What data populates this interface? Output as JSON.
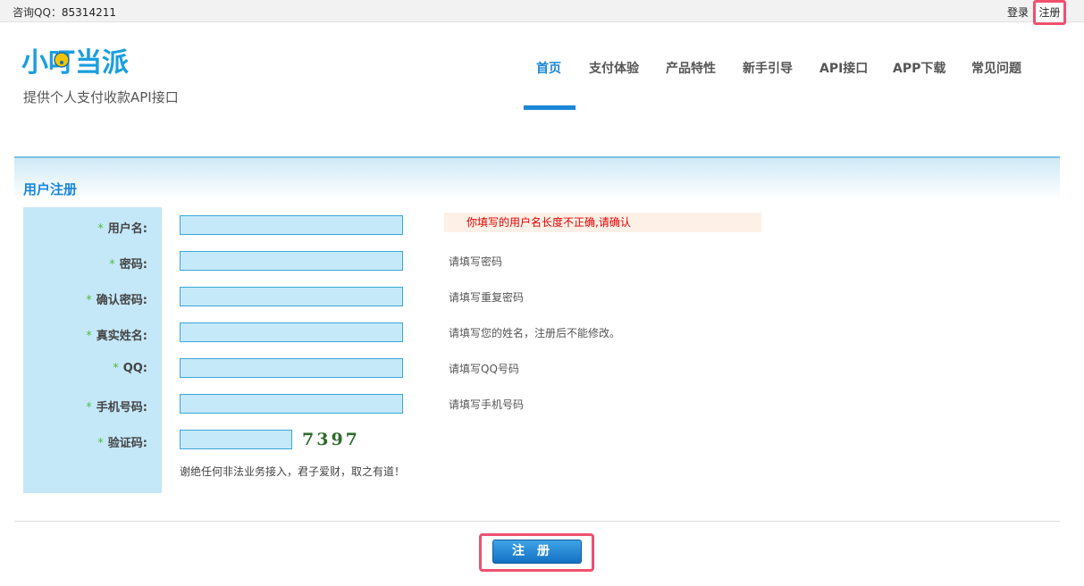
{
  "topbar": {
    "qq_label": "咨询QQ：",
    "qq_number": "85314211",
    "login": "登录",
    "register": "注册"
  },
  "header": {
    "logo_text": "小叮当派",
    "tagline": "提供个人支付收款API接口",
    "nav": [
      "首页",
      "支付体验",
      "产品特性",
      "新手引导",
      "API接口",
      "APP下载",
      "常见问题"
    ],
    "active_nav": "首页"
  },
  "section": {
    "title": "用户注册"
  },
  "form": {
    "required_mark": "*",
    "fields": [
      {
        "label": "用户名:",
        "value": "",
        "hint": "你填写的用户名长度不正确,请确认",
        "hint_is_error": true
      },
      {
        "label": "密码:",
        "value": "",
        "hint": "请填写密码"
      },
      {
        "label": "确认密码:",
        "value": "",
        "hint": "请填写重复密码"
      },
      {
        "label": "真实姓名:",
        "value": "",
        "hint": "请填写您的姓名，注册后不能修改。"
      },
      {
        "label": "QQ:",
        "value": "",
        "hint": "请填写QQ号码"
      },
      {
        "label": "手机号码:",
        "value": "",
        "hint": "请填写手机号码"
      },
      {
        "label": "验证码:",
        "value": ""
      }
    ],
    "captcha_text": "7397",
    "note": "谢绝任何非法业务接入，君子爱财，取之有道！",
    "submit": "注册"
  },
  "colors": {
    "accent": "#1a87d8",
    "highlight_border": "#f0506e",
    "error_text": "#e00000",
    "required_star": "#4bbf3b"
  }
}
